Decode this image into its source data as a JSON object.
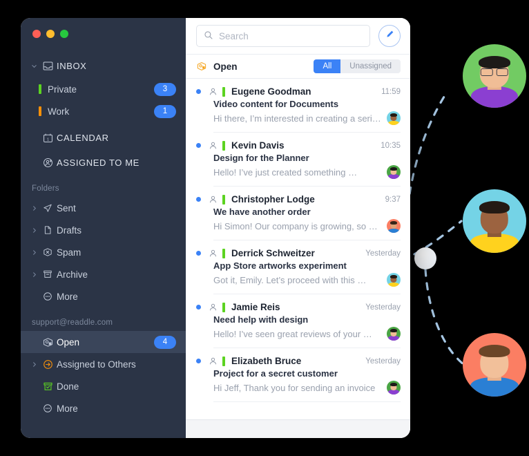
{
  "window": {
    "traffic_lights": [
      "close",
      "minimize",
      "zoom"
    ],
    "colors": {
      "sidebar_bg": "#2b3446",
      "accent_blue": "#3b82f6",
      "selected_row": "#3a455a",
      "tag_green": "#5cd321",
      "tag_orange": "#f79009",
      "traffic_red": "#ff5f56",
      "traffic_amber": "#ffbd2e",
      "traffic_green": "#27c93f"
    }
  },
  "sidebar": {
    "primary": [
      {
        "label": "INBOX",
        "icon": "inbox-icon",
        "twisty": "chevron-down-icon",
        "caps": true
      },
      {
        "label": "Private",
        "icon": "tag-icon",
        "tag_color": "#5cd321",
        "badge": "3"
      },
      {
        "label": "Work",
        "icon": "tag-icon",
        "tag_color": "#f79009",
        "badge": "1"
      },
      {
        "label": "CALENDAR",
        "icon": "calendar-icon",
        "caps": true
      },
      {
        "label": "ASSIGNED TO ME",
        "icon": "assigned-person-icon",
        "caps": true
      }
    ],
    "folders_title": "Folders",
    "folders": [
      {
        "label": "Sent",
        "icon": "send-icon",
        "twisty": "chevron-right-icon"
      },
      {
        "label": "Drafts",
        "icon": "document-icon",
        "twisty": "chevron-right-icon"
      },
      {
        "label": "Spam",
        "icon": "spam-icon",
        "twisty": "chevron-right-icon"
      },
      {
        "label": "Archive",
        "icon": "archive-icon",
        "twisty": "chevron-right-icon"
      },
      {
        "label": "More",
        "icon": "more-ellipsis-icon"
      }
    ],
    "account_title": "support@readdle.com",
    "account_folders": [
      {
        "label": "Open",
        "icon": "open-ticket-icon",
        "badge": "4",
        "selected": true
      },
      {
        "label": "Assigned to Others",
        "icon": "assigned-arrow-icon",
        "twisty": "chevron-right-icon",
        "icon_color": "#f79009"
      },
      {
        "label": "Done",
        "icon": "done-box-icon",
        "icon_color": "#5cd321"
      },
      {
        "label": "More",
        "icon": "more-ellipsis-icon"
      }
    ]
  },
  "toolbar": {
    "search_placeholder": "Search",
    "search_value": "",
    "search_icon": "search-icon",
    "compose_icon": "pencil-icon"
  },
  "list_header": {
    "icon": "open-ticket-icon",
    "title": "Open",
    "filters": [
      {
        "label": "All",
        "active": true
      },
      {
        "label": "Unassigned",
        "active": false
      }
    ]
  },
  "messages": [
    {
      "name": "Eugene Goodman",
      "subject": "Video content for Documents",
      "snippet": "Hi there, I’m interested in creating a series",
      "time": "11:59",
      "unread": true,
      "tag_color": "#5cd321",
      "avatar": "woman-cyan-yellow"
    },
    {
      "name": "Kevin Davis",
      "subject": "Design for the Planner",
      "snippet": "Hello! I’ve just created something …",
      "time": "10:35",
      "unread": true,
      "tag_color": "#5cd321",
      "avatar": "man-green-purple"
    },
    {
      "name": "Christopher Lodge",
      "subject": "We have another order",
      "snippet": "Hi Simon! Our company is growing, so …",
      "time": "9:37",
      "unread": true,
      "tag_color": "#5cd321",
      "avatar": "man-coral-blue"
    },
    {
      "name": "Derrick Schweitzer",
      "subject": "App Store artworks experiment",
      "snippet": "Got it, Emily. Let’s proceed with this …",
      "time": "Yesterday",
      "unread": true,
      "tag_color": "#5cd321",
      "avatar": "woman-cyan-yellow"
    },
    {
      "name": "Jamie Reis",
      "subject": "Need help with design",
      "snippet": "Hello! I’ve seen great reviews of your …",
      "time": "Yesterday",
      "unread": true,
      "tag_color": "#5cd321",
      "avatar": "man-green-purple"
    },
    {
      "name": "Elizabeth Bruce",
      "subject": "Project for a secret customer",
      "snippet": "Hi Jeff, Thank you for sending an invoice",
      "time": "Yesterday",
      "unread": true,
      "tag_color": "#5cd321",
      "avatar": "man-green-purple"
    }
  ],
  "contacts": [
    {
      "name": "contact-avatar-green",
      "bg": "#72cb63",
      "garment": "#8b3fd1"
    },
    {
      "name": "contact-avatar-cyan",
      "bg": "#74d3e6",
      "garment": "#ffd21e"
    },
    {
      "name": "contact-avatar-coral",
      "bg": "#fb7e63",
      "garment": "#2a7fd4"
    }
  ],
  "diagram": {
    "hub": "connection-hub-node",
    "line_color": "#a8c9e6",
    "style": "dashed"
  }
}
